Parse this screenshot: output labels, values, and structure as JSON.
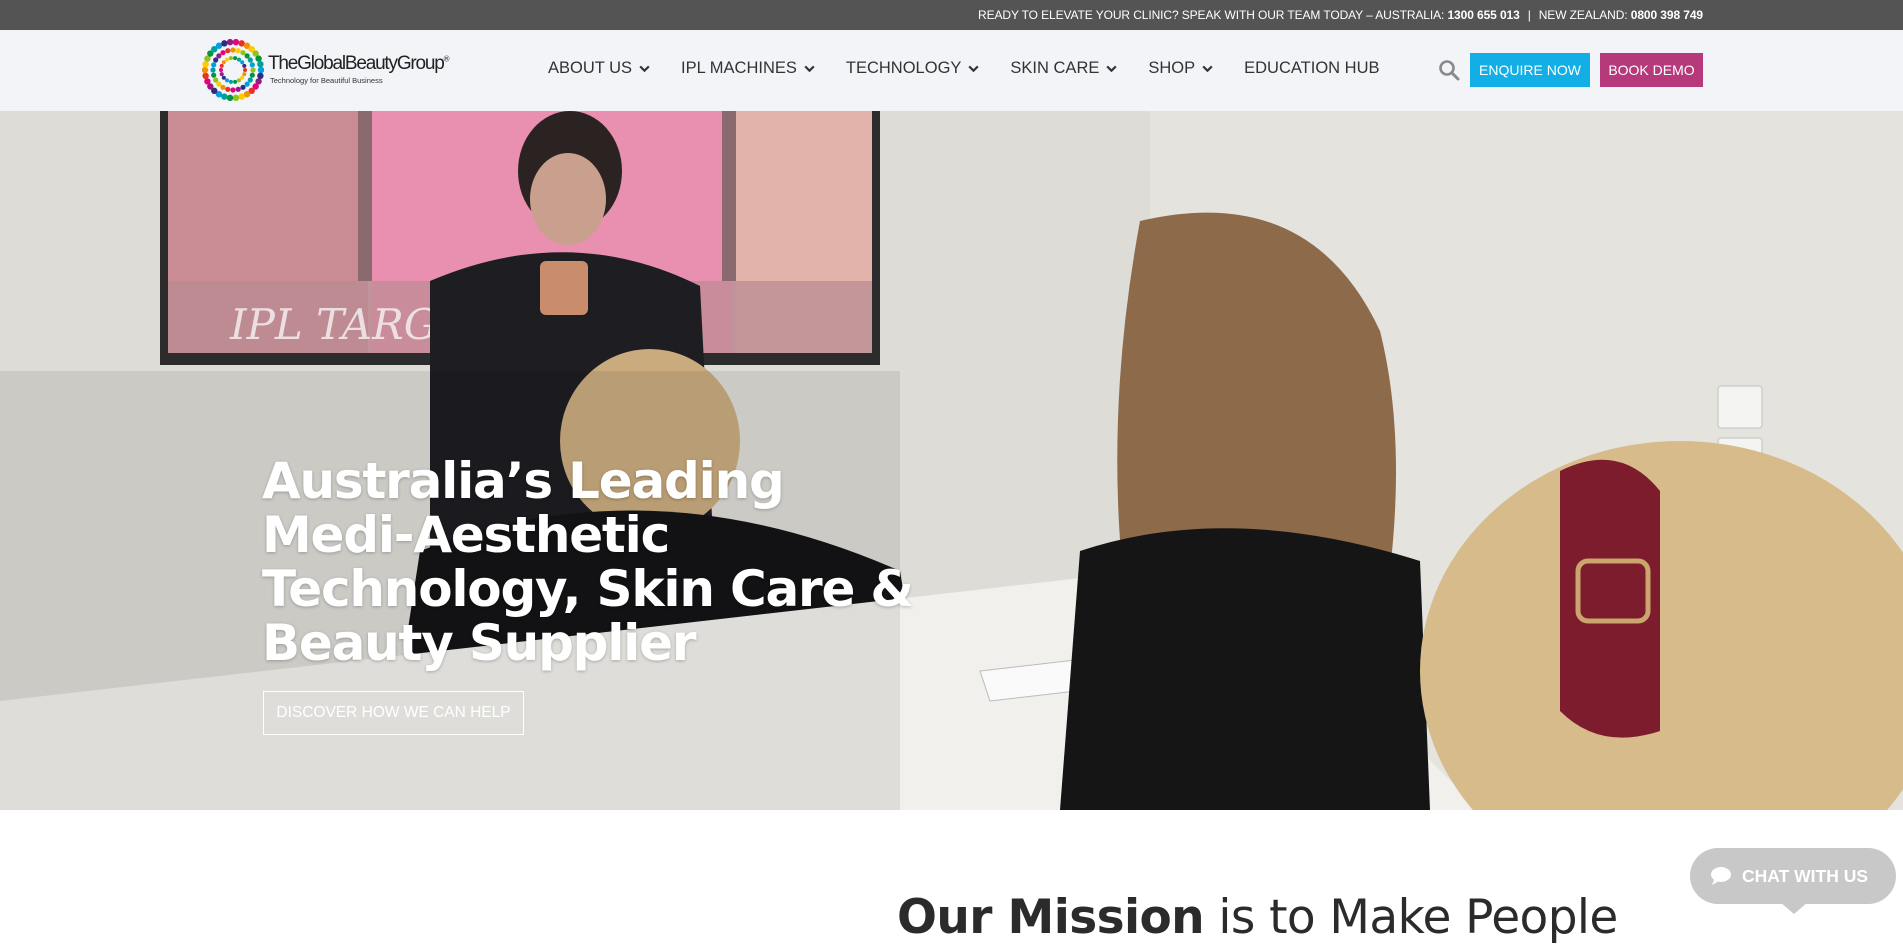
{
  "topbar": {
    "prompt": "READY TO ELEVATE YOUR CLINIC?  SPEAK WITH OUR TEAM TODAY  –  AUSTRALIA: ",
    "au_phone": "1300 655 013",
    "sep": "|",
    "nz_label": "NEW ZEALAND: ",
    "nz_phone": "0800 398 749"
  },
  "header": {
    "logo_wordmark": "TheGlobalBeautyGroup",
    "logo_reg": "®",
    "logo_tagline": "Technology for Beautiful Business",
    "nav": [
      {
        "label": "ABOUT US",
        "has_dropdown": true
      },
      {
        "label": "IPL MACHINES",
        "has_dropdown": true
      },
      {
        "label": "TECHNOLOGY",
        "has_dropdown": true
      },
      {
        "label": "SKIN CARE",
        "has_dropdown": true
      },
      {
        "label": "SHOP",
        "has_dropdown": true
      },
      {
        "label": "EDUCATION HUB",
        "has_dropdown": false
      }
    ],
    "search_icon": "search-icon",
    "enquire_label": "ENQUIRE NOW",
    "demo_label": "BOOK DEMO",
    "enquire_color": "#12aee6",
    "demo_color": "#b5397b"
  },
  "hero": {
    "title": "Australia’s Leading Medi-Aesthetic Technology, Skin Care & Beauty Supplier",
    "cta_label": "DISCOVER HOW WE CAN HELP",
    "screen_text": "IPL  TARG     ORES"
  },
  "mission": {
    "bold": "Our Mission",
    "rest": " is to Make People"
  },
  "chat": {
    "label": "CHAT WITH US",
    "icon": "chat-bubble-icon"
  }
}
